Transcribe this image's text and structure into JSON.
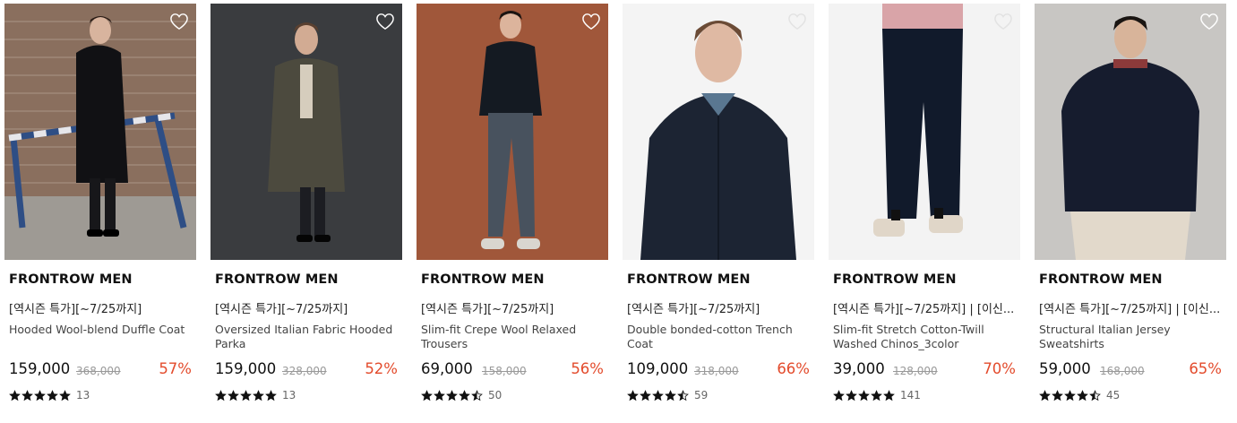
{
  "products": [
    {
      "brand": "FRONTROW MEN",
      "promo": "[역시즌 특가][~7/25까지]",
      "title": "Hooded Wool-blend Duffle Coat",
      "price": "159,000",
      "original_price": "368,000",
      "discount": "57%",
      "rating": 5,
      "review_count": "13"
    },
    {
      "brand": "FRONTROW MEN",
      "promo": "[역시즌 특가][~7/25까지]",
      "title": "Oversized Italian Fabric Hooded Parka",
      "price": "159,000",
      "original_price": "328,000",
      "discount": "52%",
      "rating": 5,
      "review_count": "13"
    },
    {
      "brand": "FRONTROW MEN",
      "promo": "[역시즌 특가][~7/25까지]",
      "title": "Slim-fit Crepe Wool Relaxed Trousers",
      "price": "69,000",
      "original_price": "158,000",
      "discount": "56%",
      "rating": 4.5,
      "review_count": "50"
    },
    {
      "brand": "FRONTROW MEN",
      "promo": "[역시즌 특가][~7/25까지]",
      "title": "Double bonded-cotton Trench Coat",
      "price": "109,000",
      "original_price": "318,000",
      "discount": "66%",
      "rating": 4.5,
      "review_count": "59"
    },
    {
      "brand": "FRONTROW MEN",
      "promo": "[역시즌 특가][~7/25까지] | [이신...",
      "title": "Slim-fit Stretch Cotton-Twill Washed Chinos_3color",
      "price": "39,000",
      "original_price": "128,000",
      "discount": "70%",
      "rating": 5,
      "review_count": "141"
    },
    {
      "brand": "FRONTROW MEN",
      "promo": "[역시즌 특가][~7/25까지] | [이신...",
      "title": "Structural Italian Jersey Sweatshirts",
      "price": "59,000",
      "original_price": "168,000",
      "discount": "65%",
      "rating": 4.5,
      "review_count": "45"
    }
  ],
  "colors": {
    "discount": "#e34b2c",
    "star": "#111111",
    "wishlist_icon": "#ffffff"
  },
  "icons": {
    "wishlist": "heart-outline-icon",
    "rating": "star-icon"
  }
}
